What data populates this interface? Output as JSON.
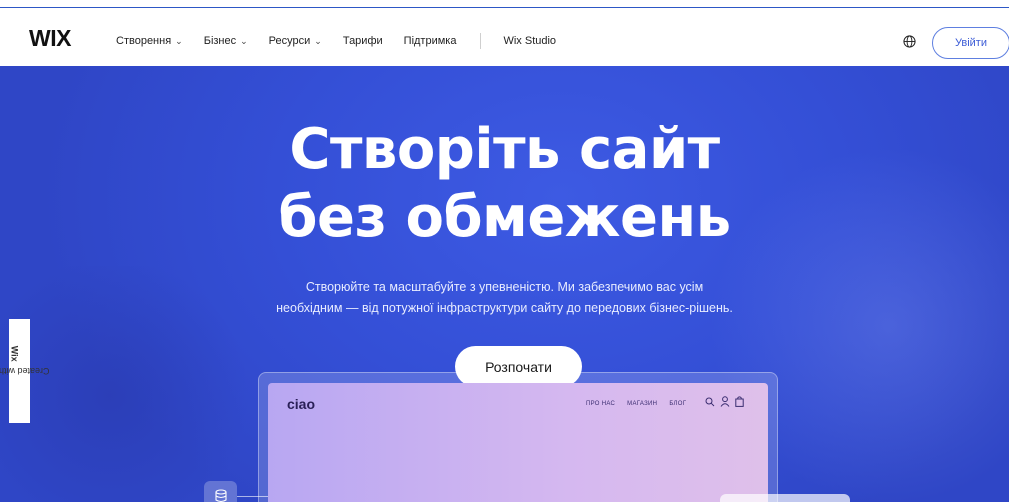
{
  "header": {
    "logo": "WIX",
    "nav": [
      {
        "label": "Створення",
        "has_dropdown": true
      },
      {
        "label": "Бізнес",
        "has_dropdown": true
      },
      {
        "label": "Ресурси",
        "has_dropdown": true
      },
      {
        "label": "Тарифи",
        "has_dropdown": false
      },
      {
        "label": "Підтримка",
        "has_dropdown": false
      }
    ],
    "studio_link": "Wix Studio",
    "globe_icon": "globe-icon",
    "login_label": "Увійти"
  },
  "hero": {
    "title_line1": "Створіть сайт",
    "title_line2": "без обмежень",
    "subtitle_line1": "Створюйте та масштабуйте з упевненістю. Ми забезпечимо вас усім",
    "subtitle_line2": "необхідним — від потужної інфраструктури сайту до передових бізнес-рішень.",
    "cta_label": "Розпочати"
  },
  "side_badge": {
    "prefix": "Created with",
    "brand": "Wix"
  },
  "mockup": {
    "logo": "ciao",
    "nav": [
      "ПРО НАС",
      "МАГАЗИН",
      "БЛОГ"
    ],
    "icons": [
      "search-icon",
      "user-icon",
      "bag-icon"
    ]
  },
  "colors": {
    "hero_bg": "#344fd6",
    "accent": "#3b5bd6",
    "text_dark": "#111111"
  }
}
